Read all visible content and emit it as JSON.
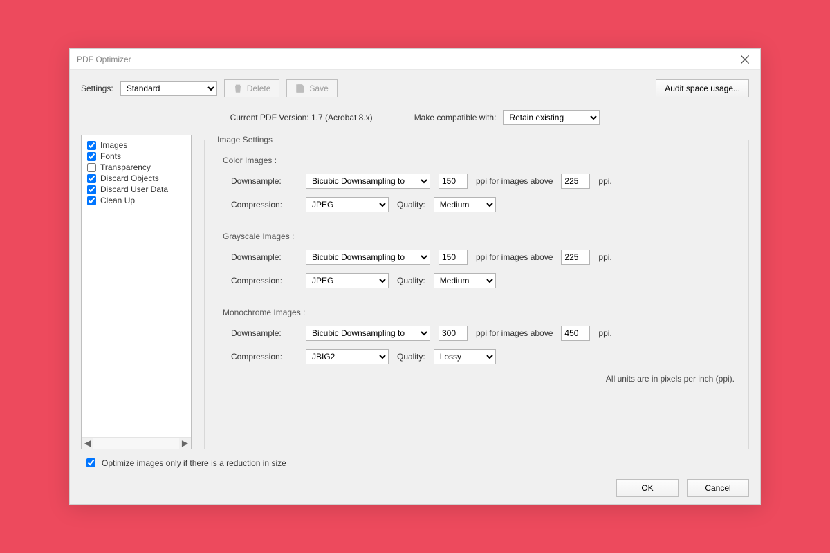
{
  "window": {
    "title": "PDF Optimizer"
  },
  "toolbar": {
    "settings_label": "Settings:",
    "settings_value": "Standard",
    "delete_label": "Delete",
    "save_label": "Save",
    "audit_label": "Audit space usage..."
  },
  "meta": {
    "current_version_label": "Current PDF Version:",
    "current_version_value": "1.7 (Acrobat 8.x)",
    "compat_label": "Make compatible with:",
    "compat_value": "Retain existing"
  },
  "categories": [
    {
      "label": "Images",
      "checked": true
    },
    {
      "label": "Fonts",
      "checked": true
    },
    {
      "label": "Transparency",
      "checked": false
    },
    {
      "label": "Discard Objects",
      "checked": true
    },
    {
      "label": "Discard User Data",
      "checked": true
    },
    {
      "label": "Clean Up",
      "checked": true
    }
  ],
  "panel": {
    "legend": "Image Settings",
    "color": {
      "title": "Color Images :",
      "downsample_label": "Downsample:",
      "downsample_value": "Bicubic Downsampling to",
      "ppi": "150",
      "above_label": "ppi for images above",
      "above_ppi": "225",
      "ppi_suffix": "ppi.",
      "compression_label": "Compression:",
      "compression_value": "JPEG",
      "quality_label": "Quality:",
      "quality_value": "Medium"
    },
    "gray": {
      "title": "Grayscale Images :",
      "downsample_label": "Downsample:",
      "downsample_value": "Bicubic Downsampling to",
      "ppi": "150",
      "above_label": "ppi for images above",
      "above_ppi": "225",
      "ppi_suffix": "ppi.",
      "compression_label": "Compression:",
      "compression_value": "JPEG",
      "quality_label": "Quality:",
      "quality_value": "Medium"
    },
    "mono": {
      "title": "Monochrome Images :",
      "downsample_label": "Downsample:",
      "downsample_value": "Bicubic Downsampling to",
      "ppi": "300",
      "above_label": "ppi for images above",
      "above_ppi": "450",
      "ppi_suffix": "ppi.",
      "compression_label": "Compression:",
      "compression_value": "JBIG2",
      "quality_label": "Quality:",
      "quality_value": "Lossy"
    },
    "units_note": "All units are in pixels per inch (ppi)."
  },
  "optimize_checkbox": {
    "label": "Optimize images only if there is a reduction in size",
    "checked": true
  },
  "footer": {
    "ok": "OK",
    "cancel": "Cancel"
  }
}
